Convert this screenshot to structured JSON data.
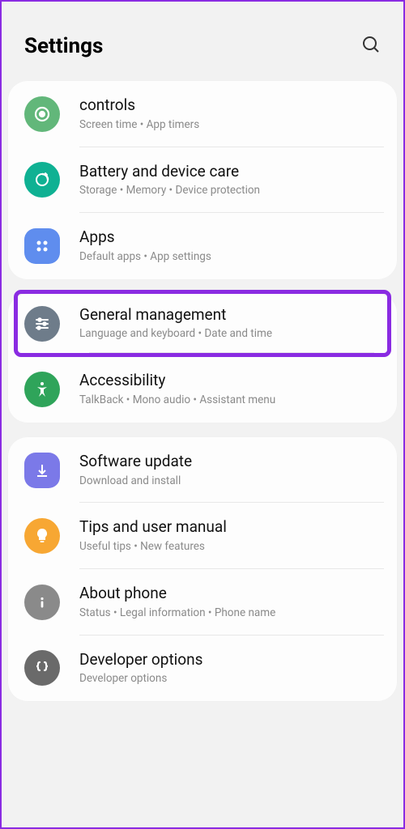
{
  "header": {
    "title": "Settings"
  },
  "group1": {
    "controls": {
      "title": "controls",
      "sub": "Screen time  •  App timers"
    },
    "battery": {
      "title": "Battery and device care",
      "sub": "Storage  •  Memory  •  Device protection"
    },
    "apps": {
      "title": "Apps",
      "sub": "Default apps  •  App settings"
    }
  },
  "group2": {
    "general": {
      "title": "General management",
      "sub": "Language and keyboard  •  Date and time"
    },
    "access": {
      "title": "Accessibility",
      "sub": "TalkBack  •  Mono audio  •  Assistant menu"
    }
  },
  "group3": {
    "software": {
      "title": "Software update",
      "sub": "Download and install"
    },
    "tips": {
      "title": "Tips and user manual",
      "sub": "Useful tips  •  New features"
    },
    "about": {
      "title": "About phone",
      "sub": "Status  •  Legal information  •  Phone name"
    },
    "dev": {
      "title": "Developer options",
      "sub": "Developer options"
    }
  }
}
